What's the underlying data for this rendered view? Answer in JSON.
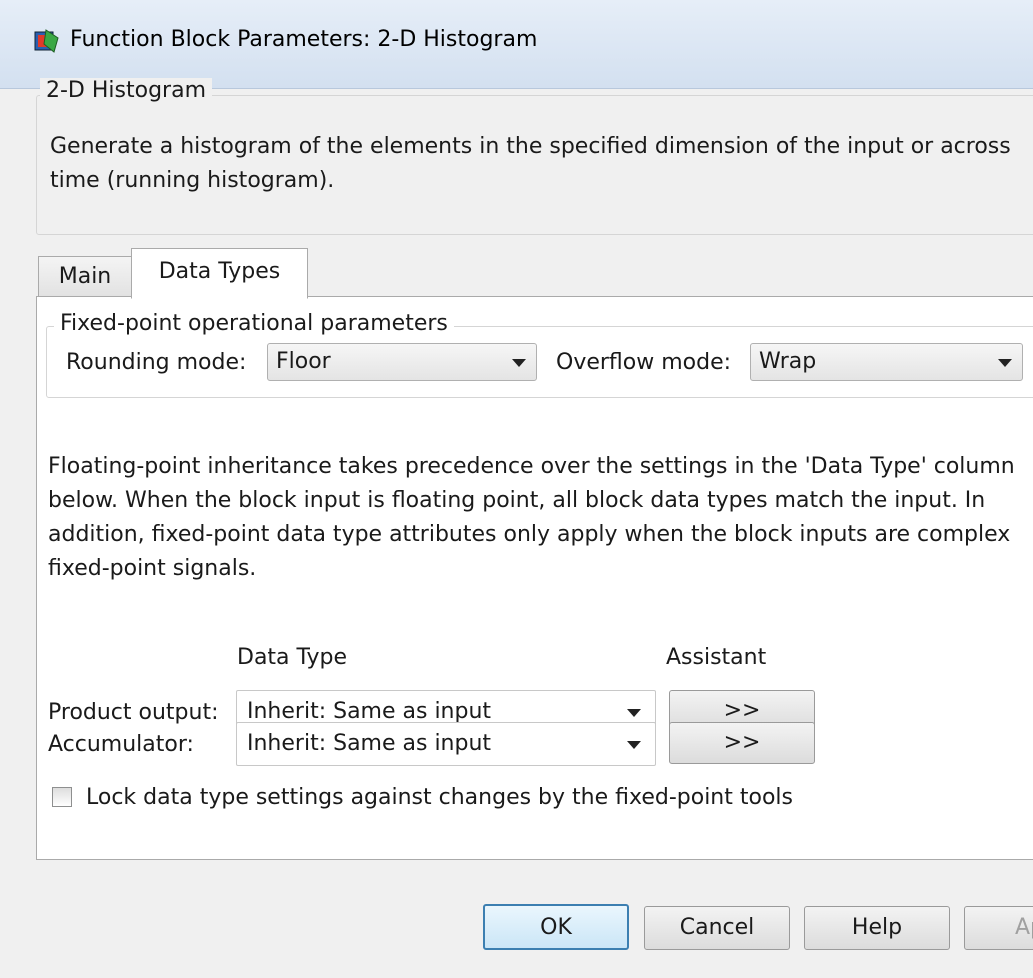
{
  "window": {
    "title": "Function Block Parameters: 2-D Histogram",
    "icon": "simulink-block-icon"
  },
  "block": {
    "name": "2-D Histogram",
    "description_lines": [
      "Generate a histogram of the elements in the specified dimension of the input or across",
      "time (running histogram)."
    ]
  },
  "tabs": [
    {
      "label": "Main",
      "selected": false
    },
    {
      "label": "Data Types",
      "selected": true
    }
  ],
  "fixed_point": {
    "legend": "Fixed-point operational parameters",
    "rounding_label": "Rounding mode:",
    "rounding_value": "Floor",
    "overflow_label": "Overflow mode:",
    "overflow_value": "Wrap"
  },
  "floating_note_lines": [
    "Floating-point inheritance takes precedence over the settings in the 'Data Type' column",
    "below. When the block input is floating point, all block data types match the input. In",
    "addition, fixed-point data type attributes only apply when the block inputs are complex",
    "fixed-point signals."
  ],
  "table": {
    "header_datatype": "Data Type",
    "header_assistant": "Assistant",
    "rows": [
      {
        "label": "Product output:",
        "value": "Inherit: Same as input",
        "assistant": ">>"
      },
      {
        "label": "Accumulator:",
        "value": "Inherit: Same as input",
        "assistant": ">>"
      }
    ]
  },
  "lock": {
    "label": "Lock data type settings against changes by the fixed-point tools",
    "checked": false
  },
  "buttons": {
    "ok": "OK",
    "cancel": "Cancel",
    "help": "Help",
    "apply": "Apply"
  }
}
